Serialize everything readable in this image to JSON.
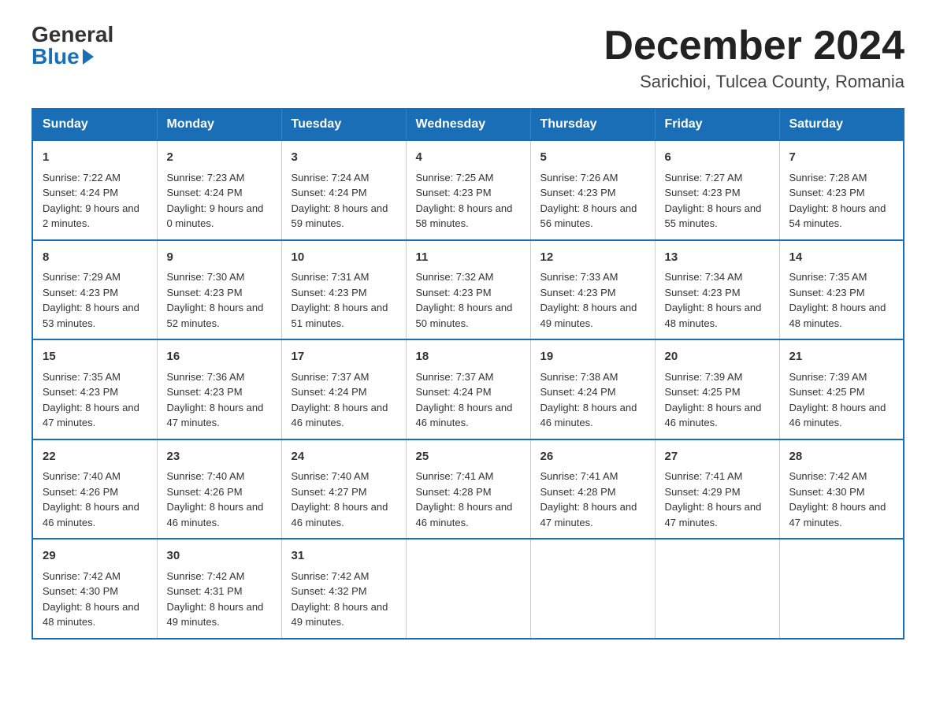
{
  "header": {
    "logo_general": "General",
    "logo_blue": "Blue",
    "month_title": "December 2024",
    "location": "Sarichioi, Tulcea County, Romania"
  },
  "weekdays": [
    "Sunday",
    "Monday",
    "Tuesday",
    "Wednesday",
    "Thursday",
    "Friday",
    "Saturday"
  ],
  "weeks": [
    [
      {
        "day": "1",
        "sunrise": "7:22 AM",
        "sunset": "4:24 PM",
        "daylight": "9 hours and 2 minutes."
      },
      {
        "day": "2",
        "sunrise": "7:23 AM",
        "sunset": "4:24 PM",
        "daylight": "9 hours and 0 minutes."
      },
      {
        "day": "3",
        "sunrise": "7:24 AM",
        "sunset": "4:24 PM",
        "daylight": "8 hours and 59 minutes."
      },
      {
        "day": "4",
        "sunrise": "7:25 AM",
        "sunset": "4:23 PM",
        "daylight": "8 hours and 58 minutes."
      },
      {
        "day": "5",
        "sunrise": "7:26 AM",
        "sunset": "4:23 PM",
        "daylight": "8 hours and 56 minutes."
      },
      {
        "day": "6",
        "sunrise": "7:27 AM",
        "sunset": "4:23 PM",
        "daylight": "8 hours and 55 minutes."
      },
      {
        "day": "7",
        "sunrise": "7:28 AM",
        "sunset": "4:23 PM",
        "daylight": "8 hours and 54 minutes."
      }
    ],
    [
      {
        "day": "8",
        "sunrise": "7:29 AM",
        "sunset": "4:23 PM",
        "daylight": "8 hours and 53 minutes."
      },
      {
        "day": "9",
        "sunrise": "7:30 AM",
        "sunset": "4:23 PM",
        "daylight": "8 hours and 52 minutes."
      },
      {
        "day": "10",
        "sunrise": "7:31 AM",
        "sunset": "4:23 PM",
        "daylight": "8 hours and 51 minutes."
      },
      {
        "day": "11",
        "sunrise": "7:32 AM",
        "sunset": "4:23 PM",
        "daylight": "8 hours and 50 minutes."
      },
      {
        "day": "12",
        "sunrise": "7:33 AM",
        "sunset": "4:23 PM",
        "daylight": "8 hours and 49 minutes."
      },
      {
        "day": "13",
        "sunrise": "7:34 AM",
        "sunset": "4:23 PM",
        "daylight": "8 hours and 48 minutes."
      },
      {
        "day": "14",
        "sunrise": "7:35 AM",
        "sunset": "4:23 PM",
        "daylight": "8 hours and 48 minutes."
      }
    ],
    [
      {
        "day": "15",
        "sunrise": "7:35 AM",
        "sunset": "4:23 PM",
        "daylight": "8 hours and 47 minutes."
      },
      {
        "day": "16",
        "sunrise": "7:36 AM",
        "sunset": "4:23 PM",
        "daylight": "8 hours and 47 minutes."
      },
      {
        "day": "17",
        "sunrise": "7:37 AM",
        "sunset": "4:24 PM",
        "daylight": "8 hours and 46 minutes."
      },
      {
        "day": "18",
        "sunrise": "7:37 AM",
        "sunset": "4:24 PM",
        "daylight": "8 hours and 46 minutes."
      },
      {
        "day": "19",
        "sunrise": "7:38 AM",
        "sunset": "4:24 PM",
        "daylight": "8 hours and 46 minutes."
      },
      {
        "day": "20",
        "sunrise": "7:39 AM",
        "sunset": "4:25 PM",
        "daylight": "8 hours and 46 minutes."
      },
      {
        "day": "21",
        "sunrise": "7:39 AM",
        "sunset": "4:25 PM",
        "daylight": "8 hours and 46 minutes."
      }
    ],
    [
      {
        "day": "22",
        "sunrise": "7:40 AM",
        "sunset": "4:26 PM",
        "daylight": "8 hours and 46 minutes."
      },
      {
        "day": "23",
        "sunrise": "7:40 AM",
        "sunset": "4:26 PM",
        "daylight": "8 hours and 46 minutes."
      },
      {
        "day": "24",
        "sunrise": "7:40 AM",
        "sunset": "4:27 PM",
        "daylight": "8 hours and 46 minutes."
      },
      {
        "day": "25",
        "sunrise": "7:41 AM",
        "sunset": "4:28 PM",
        "daylight": "8 hours and 46 minutes."
      },
      {
        "day": "26",
        "sunrise": "7:41 AM",
        "sunset": "4:28 PM",
        "daylight": "8 hours and 47 minutes."
      },
      {
        "day": "27",
        "sunrise": "7:41 AM",
        "sunset": "4:29 PM",
        "daylight": "8 hours and 47 minutes."
      },
      {
        "day": "28",
        "sunrise": "7:42 AM",
        "sunset": "4:30 PM",
        "daylight": "8 hours and 47 minutes."
      }
    ],
    [
      {
        "day": "29",
        "sunrise": "7:42 AM",
        "sunset": "4:30 PM",
        "daylight": "8 hours and 48 minutes."
      },
      {
        "day": "30",
        "sunrise": "7:42 AM",
        "sunset": "4:31 PM",
        "daylight": "8 hours and 49 minutes."
      },
      {
        "day": "31",
        "sunrise": "7:42 AM",
        "sunset": "4:32 PM",
        "daylight": "8 hours and 49 minutes."
      },
      null,
      null,
      null,
      null
    ]
  ],
  "labels": {
    "sunrise": "Sunrise:",
    "sunset": "Sunset:",
    "daylight": "Daylight:"
  }
}
